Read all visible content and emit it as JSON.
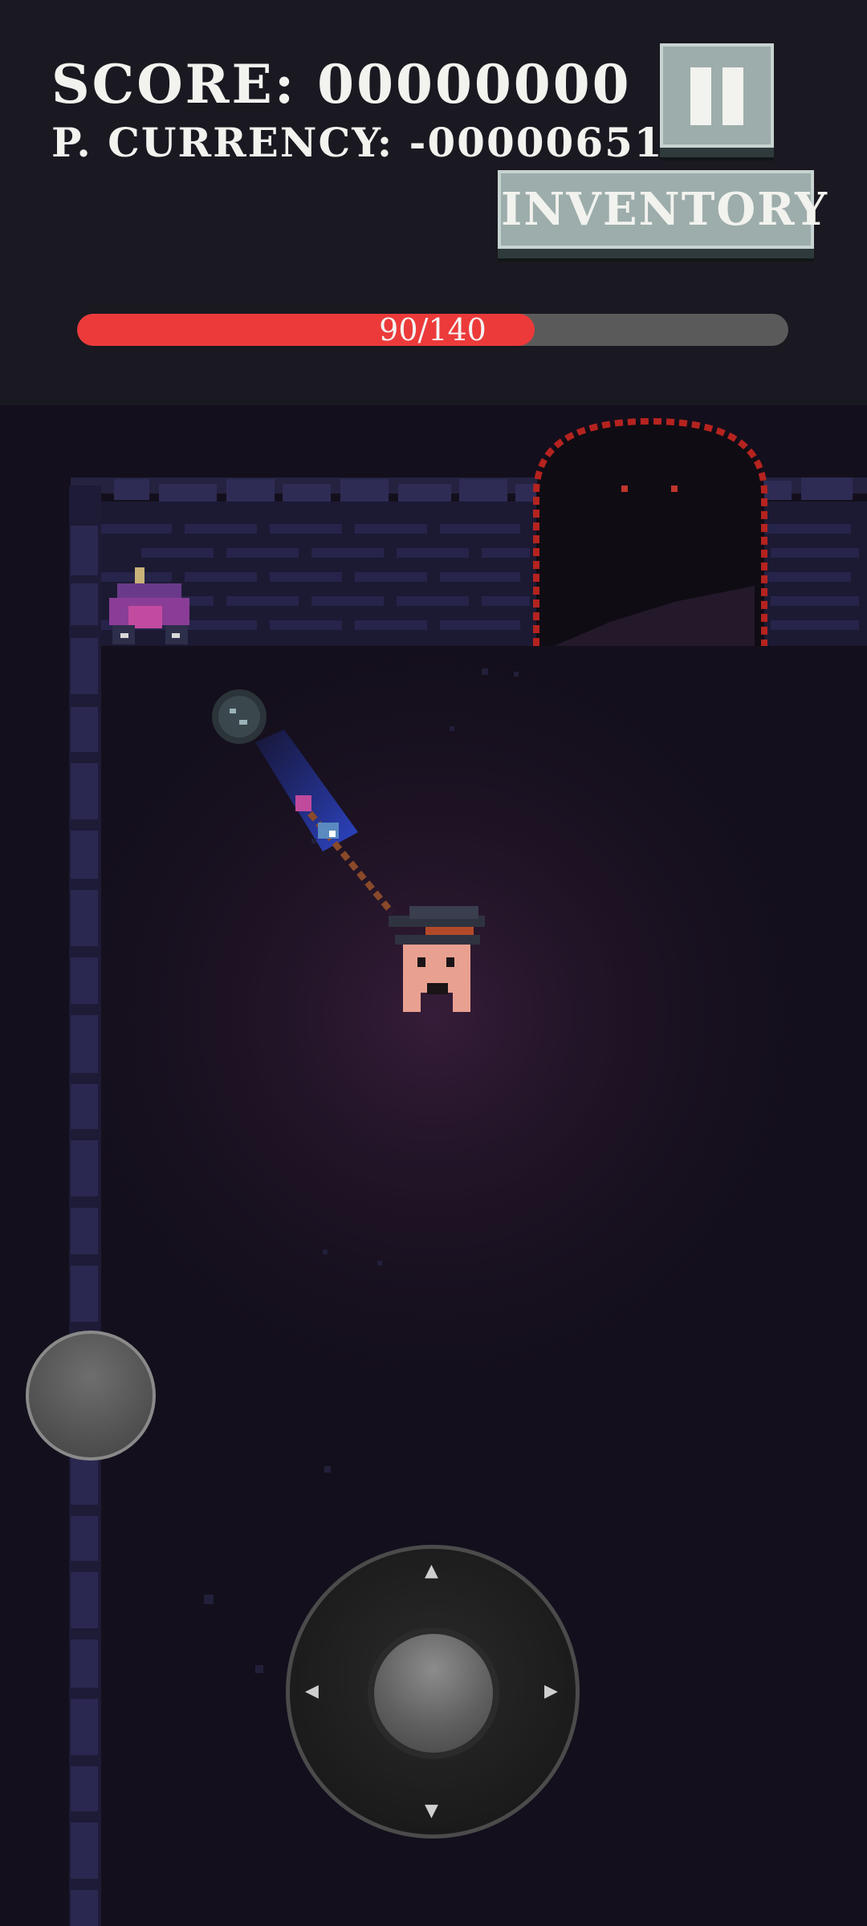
{
  "hud": {
    "score_text": "SCORE: 00000000",
    "currency_text": "P. CURRENCY: -00000651",
    "inventory_label": "INVENTORY",
    "health": {
      "current": 90,
      "max": 140,
      "text": "90/140",
      "fill_color": "#ec3a3a"
    }
  },
  "controls": {
    "pause_icon": "pause-icon",
    "dpad_up": "▲",
    "dpad_down": "▼",
    "dpad_left": "◀",
    "dpad_right": "▶"
  },
  "colors": {
    "hud_bg": "#1a1820",
    "world_bg": "#140f1c",
    "button": "#9cadab",
    "wall": "#2c2a4e"
  }
}
